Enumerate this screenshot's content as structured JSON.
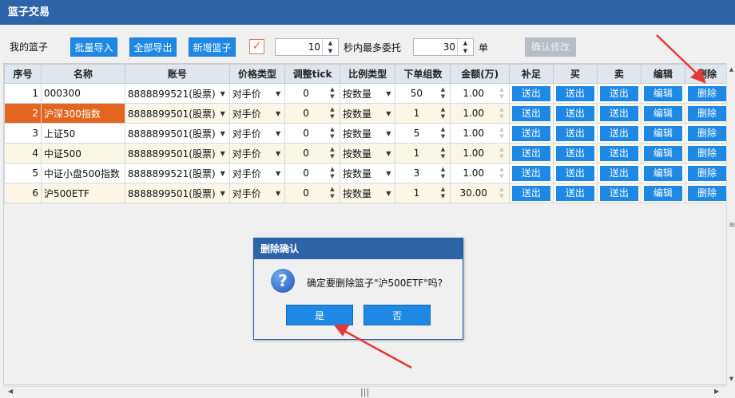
{
  "window": {
    "title": "篮子交易"
  },
  "toolbar": {
    "label": "我的篮子",
    "import_btn": "批量导入",
    "export_btn": "全部导出",
    "add_btn": "新增篮子",
    "checkbox_checked": true,
    "seconds_value": "10",
    "seconds_text": "秒内最多委托",
    "orders_value": "30",
    "orders_text": "单",
    "confirm_btn": "确认修改"
  },
  "table": {
    "headers": [
      "序号",
      "名称",
      "账号",
      "价格类型",
      "调整tick",
      "比例类型",
      "下单组数",
      "金额(万)",
      "补足",
      "买",
      "卖",
      "编辑",
      "删除"
    ],
    "rows": [
      {
        "idx": "1",
        "name": "000300",
        "account": "8888899521(股票)",
        "price_type": "对手价",
        "tick": "0",
        "ratio_type": "按数量",
        "groups": "50",
        "amount": "1.00",
        "fill": "送出",
        "buy": "送出",
        "sell": "送出",
        "edit": "编辑",
        "del": "删除"
      },
      {
        "idx": "2",
        "name": "沪深300指数",
        "account": "8888899501(股票)",
        "price_type": "对手价",
        "tick": "0",
        "ratio_type": "按数量",
        "groups": "1",
        "amount": "1.00",
        "fill": "送出",
        "buy": "送出",
        "sell": "送出",
        "edit": "编辑",
        "del": "删除"
      },
      {
        "idx": "3",
        "name": "上证50",
        "account": "8888899501(股票)",
        "price_type": "对手价",
        "tick": "0",
        "ratio_type": "按数量",
        "groups": "5",
        "amount": "1.00",
        "fill": "送出",
        "buy": "送出",
        "sell": "送出",
        "edit": "编辑",
        "del": "删除"
      },
      {
        "idx": "4",
        "name": "中证500",
        "account": "8888899501(股票)",
        "price_type": "对手价",
        "tick": "0",
        "ratio_type": "按数量",
        "groups": "1",
        "amount": "1.00",
        "fill": "送出",
        "buy": "送出",
        "sell": "送出",
        "edit": "编辑",
        "del": "删除"
      },
      {
        "idx": "5",
        "name": "中证小盘500指数",
        "account": "8888899521(股票)",
        "price_type": "对手价",
        "tick": "0",
        "ratio_type": "按数量",
        "groups": "3",
        "amount": "1.00",
        "fill": "送出",
        "buy": "送出",
        "sell": "送出",
        "edit": "编辑",
        "del": "删除"
      },
      {
        "idx": "6",
        "name": "沪500ETF",
        "account": "8888899501(股票)",
        "price_type": "对手价",
        "tick": "0",
        "ratio_type": "按数量",
        "groups": "1",
        "amount": "30.00",
        "fill": "送出",
        "buy": "送出",
        "sell": "送出",
        "edit": "编辑",
        "del": "删除"
      }
    ],
    "selected_row": 1
  },
  "dialog": {
    "title": "删除确认",
    "message": "确定要删除篮子\"沪500ETF\"吗?",
    "yes_btn": "是",
    "no_btn": "否",
    "icon": "question-icon"
  },
  "colors": {
    "title_bar": "#2d64a8",
    "button_blue": "#1e88e5",
    "selected_row": "#e2661f",
    "alt_row": "#fcf6e6",
    "annotation_arrow": "#e53935"
  }
}
